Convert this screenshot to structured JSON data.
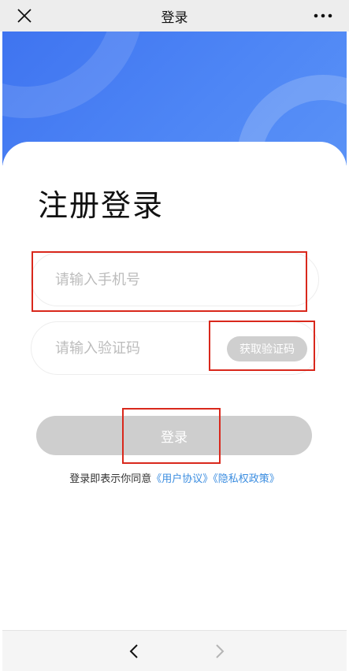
{
  "topbar": {
    "title": "登录",
    "close_icon": "close-icon",
    "more_icon": "more-icon"
  },
  "login": {
    "heading": "注册登录",
    "phone_placeholder": "请输入手机号",
    "code_placeholder": "请输入验证码",
    "get_code_label": "获取验证码",
    "login_label": "登录"
  },
  "agreement": {
    "prefix": "登录即表示你同意",
    "user_agreement": "《用户协议》",
    "privacy_policy": "《隐私权政策》"
  },
  "bottombar": {
    "back_icon": "chevron-left-icon",
    "forward_icon": "chevron-right-icon"
  },
  "colors": {
    "brand_blue": "#4a80f2",
    "link": "#3b8de0",
    "disabled_button": "#cecece",
    "annotation_red": "#d9281c"
  }
}
